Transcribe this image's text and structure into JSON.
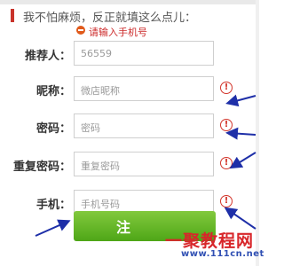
{
  "header": {
    "note": "我不怕麻烦，反正就填这么点儿："
  },
  "validation": {
    "error_message": "请输入手机号"
  },
  "form": {
    "referrer": {
      "label": "推荐人：",
      "value": "56559"
    },
    "nickname": {
      "label": "昵称：",
      "placeholder": "微店昵称"
    },
    "password": {
      "label": "密码：",
      "placeholder": "密码"
    },
    "confirm_password": {
      "label": "重复密码：",
      "placeholder": "重复密码"
    },
    "phone": {
      "label": "手机：",
      "placeholder": "手机号码"
    },
    "submit_label": "注"
  },
  "watermark": {
    "logo_text": "一聚教程网",
    "url_text": "www.111cn.net"
  },
  "colors": {
    "accent_red": "#c9332b",
    "error_red": "#cc2a2a",
    "submit_green": "#5aad20",
    "annotation_arrow_blue": "#1e2fa8"
  },
  "icons": {
    "error": "minus-circle-icon",
    "warning": "exclamation-circle-icon",
    "arrow": "annotation-arrow-icon"
  }
}
